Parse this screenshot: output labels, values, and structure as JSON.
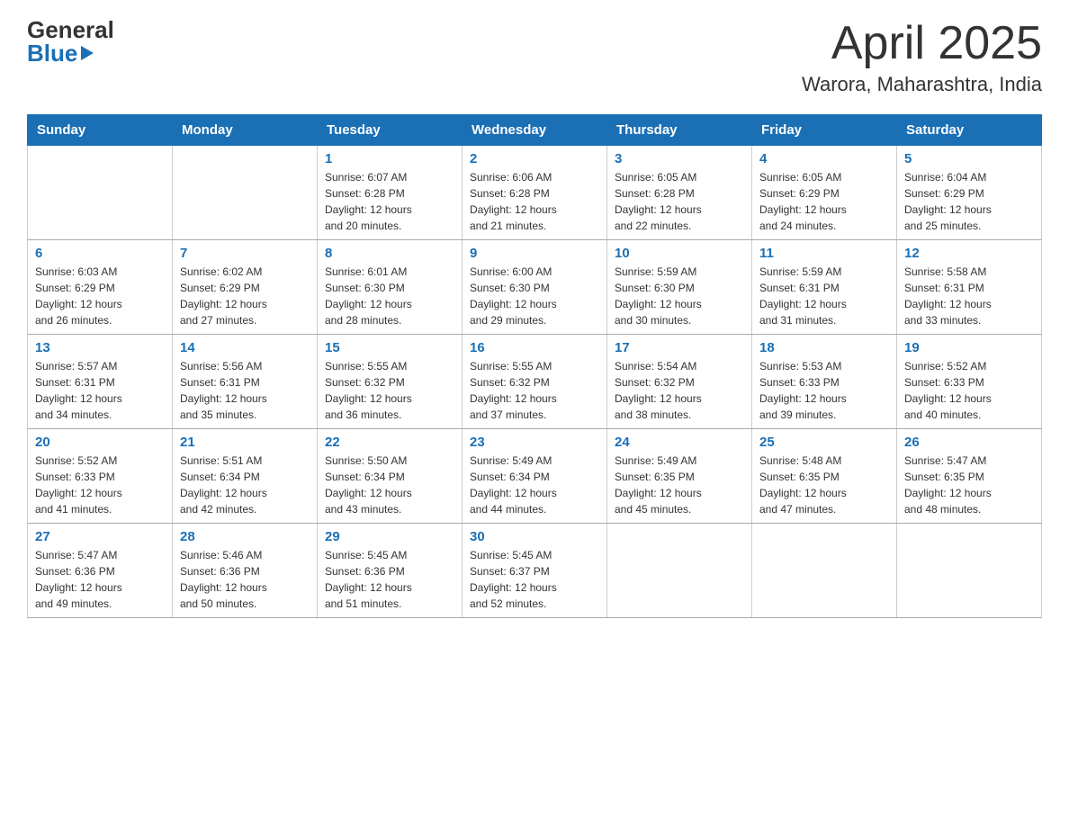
{
  "header": {
    "logo": {
      "general": "General",
      "blue": "Blue",
      "triangle": "▲"
    },
    "title": "April 2025",
    "location": "Warora, Maharashtra, India"
  },
  "calendar": {
    "days_of_week": [
      "Sunday",
      "Monday",
      "Tuesday",
      "Wednesday",
      "Thursday",
      "Friday",
      "Saturday"
    ],
    "weeks": [
      [
        {
          "day": "",
          "info": ""
        },
        {
          "day": "",
          "info": ""
        },
        {
          "day": "1",
          "info": "Sunrise: 6:07 AM\nSunset: 6:28 PM\nDaylight: 12 hours\nand 20 minutes."
        },
        {
          "day": "2",
          "info": "Sunrise: 6:06 AM\nSunset: 6:28 PM\nDaylight: 12 hours\nand 21 minutes."
        },
        {
          "day": "3",
          "info": "Sunrise: 6:05 AM\nSunset: 6:28 PM\nDaylight: 12 hours\nand 22 minutes."
        },
        {
          "day": "4",
          "info": "Sunrise: 6:05 AM\nSunset: 6:29 PM\nDaylight: 12 hours\nand 24 minutes."
        },
        {
          "day": "5",
          "info": "Sunrise: 6:04 AM\nSunset: 6:29 PM\nDaylight: 12 hours\nand 25 minutes."
        }
      ],
      [
        {
          "day": "6",
          "info": "Sunrise: 6:03 AM\nSunset: 6:29 PM\nDaylight: 12 hours\nand 26 minutes."
        },
        {
          "day": "7",
          "info": "Sunrise: 6:02 AM\nSunset: 6:29 PM\nDaylight: 12 hours\nand 27 minutes."
        },
        {
          "day": "8",
          "info": "Sunrise: 6:01 AM\nSunset: 6:30 PM\nDaylight: 12 hours\nand 28 minutes."
        },
        {
          "day": "9",
          "info": "Sunrise: 6:00 AM\nSunset: 6:30 PM\nDaylight: 12 hours\nand 29 minutes."
        },
        {
          "day": "10",
          "info": "Sunrise: 5:59 AM\nSunset: 6:30 PM\nDaylight: 12 hours\nand 30 minutes."
        },
        {
          "day": "11",
          "info": "Sunrise: 5:59 AM\nSunset: 6:31 PM\nDaylight: 12 hours\nand 31 minutes."
        },
        {
          "day": "12",
          "info": "Sunrise: 5:58 AM\nSunset: 6:31 PM\nDaylight: 12 hours\nand 33 minutes."
        }
      ],
      [
        {
          "day": "13",
          "info": "Sunrise: 5:57 AM\nSunset: 6:31 PM\nDaylight: 12 hours\nand 34 minutes."
        },
        {
          "day": "14",
          "info": "Sunrise: 5:56 AM\nSunset: 6:31 PM\nDaylight: 12 hours\nand 35 minutes."
        },
        {
          "day": "15",
          "info": "Sunrise: 5:55 AM\nSunset: 6:32 PM\nDaylight: 12 hours\nand 36 minutes."
        },
        {
          "day": "16",
          "info": "Sunrise: 5:55 AM\nSunset: 6:32 PM\nDaylight: 12 hours\nand 37 minutes."
        },
        {
          "day": "17",
          "info": "Sunrise: 5:54 AM\nSunset: 6:32 PM\nDaylight: 12 hours\nand 38 minutes."
        },
        {
          "day": "18",
          "info": "Sunrise: 5:53 AM\nSunset: 6:33 PM\nDaylight: 12 hours\nand 39 minutes."
        },
        {
          "day": "19",
          "info": "Sunrise: 5:52 AM\nSunset: 6:33 PM\nDaylight: 12 hours\nand 40 minutes."
        }
      ],
      [
        {
          "day": "20",
          "info": "Sunrise: 5:52 AM\nSunset: 6:33 PM\nDaylight: 12 hours\nand 41 minutes."
        },
        {
          "day": "21",
          "info": "Sunrise: 5:51 AM\nSunset: 6:34 PM\nDaylight: 12 hours\nand 42 minutes."
        },
        {
          "day": "22",
          "info": "Sunrise: 5:50 AM\nSunset: 6:34 PM\nDaylight: 12 hours\nand 43 minutes."
        },
        {
          "day": "23",
          "info": "Sunrise: 5:49 AM\nSunset: 6:34 PM\nDaylight: 12 hours\nand 44 minutes."
        },
        {
          "day": "24",
          "info": "Sunrise: 5:49 AM\nSunset: 6:35 PM\nDaylight: 12 hours\nand 45 minutes."
        },
        {
          "day": "25",
          "info": "Sunrise: 5:48 AM\nSunset: 6:35 PM\nDaylight: 12 hours\nand 47 minutes."
        },
        {
          "day": "26",
          "info": "Sunrise: 5:47 AM\nSunset: 6:35 PM\nDaylight: 12 hours\nand 48 minutes."
        }
      ],
      [
        {
          "day": "27",
          "info": "Sunrise: 5:47 AM\nSunset: 6:36 PM\nDaylight: 12 hours\nand 49 minutes."
        },
        {
          "day": "28",
          "info": "Sunrise: 5:46 AM\nSunset: 6:36 PM\nDaylight: 12 hours\nand 50 minutes."
        },
        {
          "day": "29",
          "info": "Sunrise: 5:45 AM\nSunset: 6:36 PM\nDaylight: 12 hours\nand 51 minutes."
        },
        {
          "day": "30",
          "info": "Sunrise: 5:45 AM\nSunset: 6:37 PM\nDaylight: 12 hours\nand 52 minutes."
        },
        {
          "day": "",
          "info": ""
        },
        {
          "day": "",
          "info": ""
        },
        {
          "day": "",
          "info": ""
        }
      ]
    ]
  }
}
